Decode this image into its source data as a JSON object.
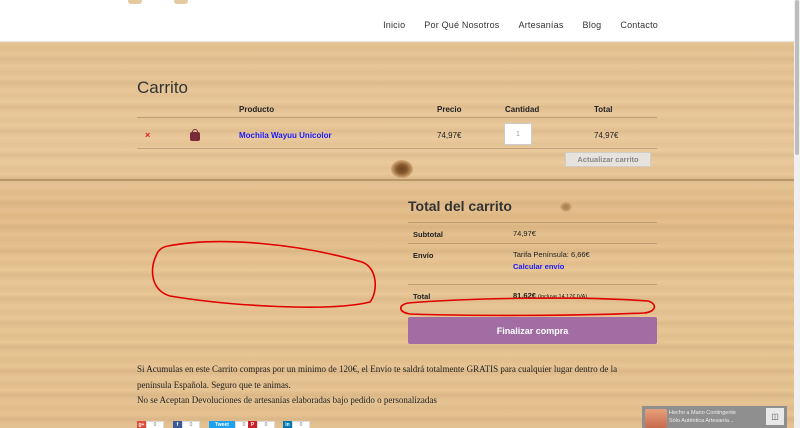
{
  "nav": {
    "items": [
      "Inicio",
      "Por Qué Nosotros",
      "Artesanías",
      "Blog",
      "Contacto"
    ]
  },
  "cart": {
    "title": "Carrito",
    "headers": {
      "product": "Producto",
      "price": "Precio",
      "quantity": "Cantidad",
      "total": "Total"
    },
    "remove_symbol": "×",
    "item": {
      "name": "Mochila Wayuu Unicolor",
      "price": "74,97€",
      "quantity": "1",
      "total": "74,97€"
    },
    "update_label": "Actualizar carrito"
  },
  "totals": {
    "title": "Total del carrito",
    "subtotal_label": "Subtotal",
    "subtotal_value": "74,97€",
    "shipping_label": "Envío",
    "shipping_value": "Tarifa Península: 6,66€",
    "calc_shipping": "Calcular envío",
    "total_label": "Total",
    "total_value": "81,62€",
    "total_note": "(incluye 14,17€ IVA)",
    "checkout_label": "Finalizar compra"
  },
  "notes": {
    "line1": "Si Acumulas en este Carrito compras por un mínimo de 120€, el Envío te saldrá totalmente GRATIS para cualquier lugar dentro de la",
    "line2": "península Española. Seguro que te animas.",
    "line3": "No se Aceptan Devoluciones de artesanías elaboradas bajo pedido o personalizadas"
  },
  "share": [
    {
      "icon": "g+",
      "count": "0",
      "color": "#dd4b39"
    },
    {
      "icon": "f",
      "count": "0",
      "color": "#3b5998"
    },
    {
      "icon": "Tweet",
      "count": "0",
      "color": "#1da1f2"
    },
    {
      "icon": "P",
      "count": "0",
      "color": "#cb2027"
    },
    {
      "icon": "in",
      "count": "0",
      "color": "#0077b5"
    }
  ],
  "popup": {
    "line1": "Hecho a Mano Contingente",
    "line2": "Sólo Auténtica Artesanía...",
    "icon": "window-icon"
  },
  "colors": {
    "checkout": "#a16da3",
    "link": "#1a1aff",
    "remove": "#e02020",
    "annotation": "#e00000"
  }
}
